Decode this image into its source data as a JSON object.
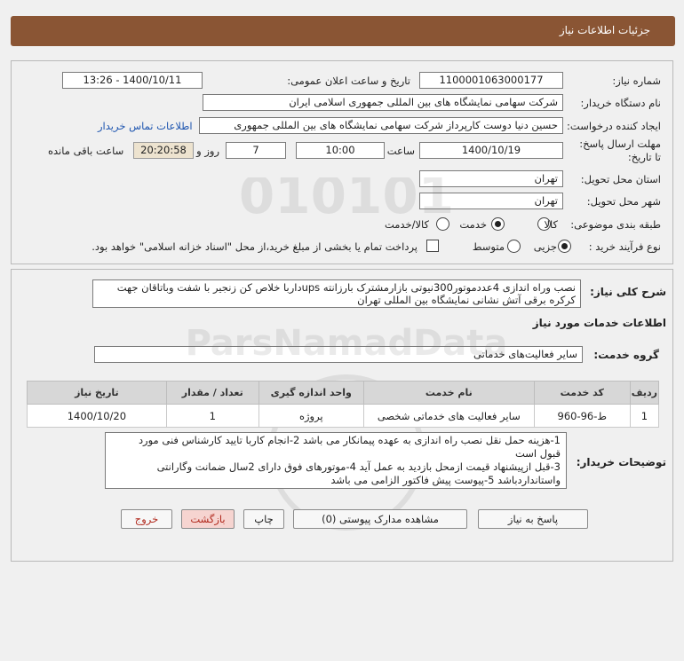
{
  "header": {
    "title": "جزئیات اطلاعات نیاز"
  },
  "form": {
    "need_number_label": "شماره نیاز:",
    "need_number": "1100001063000177",
    "announce_label": "تاریخ و ساعت اعلان عمومی:",
    "announce_value": "1400/10/11 - 13:26",
    "buyer_label": "نام دستگاه خریدار:",
    "buyer_value": "شرکت سهامی نمایشگاه های بین المللی جمهوری اسلامی ایران",
    "creator_label": "ایجاد کننده درخواست:",
    "creator_value": "حسین دنیا دوست کارپرداز شرکت سهامی نمایشگاه های بین المللی جمهوری",
    "contact_link": "اطلاعات تماس خریدار",
    "deadline_label": "مهلت ارسال پاسخ: تا تاریخ:",
    "deadline_date": "1400/10/19",
    "time_label": "ساعت",
    "deadline_time": "10:00",
    "days_value": "7",
    "days_label": "روز و",
    "remaining_time": "20:20:58",
    "remaining_label": "ساعت باقی مانده",
    "province_label": "استان محل تحویل:",
    "province_value": "تهران",
    "city_label": "شهر محل تحویل:",
    "city_value": "تهران",
    "category_label": "طبقه بندی موضوعی:",
    "category_options": [
      "کالا",
      "خدمت",
      "کالا/خدمت"
    ],
    "category_selected": "خدمت",
    "purchase_type_label": "نوع فرآیند خرید :",
    "purchase_options": [
      "جزیی",
      "متوسط"
    ],
    "purchase_selected": "جزیی",
    "payment_note": "پرداخت تمام یا بخشی از مبلغ خرید،از محل \"اسناد خزانه اسلامی\" خواهد بود."
  },
  "description": {
    "label": "شرح کلی نیاز:",
    "line1": "نصب وراه اندازی 4عددموتور300نیوتی بازارمشترک بارزانته upsداربا خلاص کن زنجیر با شفت وباتاقان جهت",
    "line2": "کرکره برقی آتش نشانی نمایشگاه بین المللی تهران"
  },
  "services": {
    "section_title": "اطلاعات خدمات مورد نیاز",
    "group_label": "گروه خدمت:",
    "group_value": "سایر فعالیت‌های خدماتی",
    "columns": [
      "ردیف",
      "کد خدمت",
      "نام خدمت",
      "واحد اندازه گیری",
      "تعداد / مقدار",
      "تاریخ نیاز"
    ],
    "rows": [
      [
        "1",
        "ط-96-960",
        "سایر فعالیت های خدماتی شخصی",
        "پروژه",
        "1",
        "1400/10/20"
      ]
    ]
  },
  "buyer_notes": {
    "label": "توضیحات خریدار:",
    "line1": "1-هزینه حمل  نقل نصب راه اندازی به عهده پیمانکار می باشد 2-انجام کاربا تایید کارشناس فنی مورد",
    "line2": "قبول است",
    "line3": "3-قبل ازپیشنهاد قیمت ازمحل بازدید به عمل آید 4-موتورهای فوق دارای 2سال ضمانت وگارانتی",
    "line4": "واستانداردباشد 5-پیوست پیش فاکتور الزامی می باشد"
  },
  "buttons": {
    "reply": "پاسخ به نیاز",
    "attachments": "مشاهده مدارک پیوستی (0)",
    "print": "چاپ",
    "back": "بازگشت",
    "exit": "خروج"
  },
  "watermark": {
    "text": "ParsNamadData"
  },
  "colors": {
    "header": "#8a5534",
    "link": "#1f56b0",
    "exit": "#b0281c"
  }
}
